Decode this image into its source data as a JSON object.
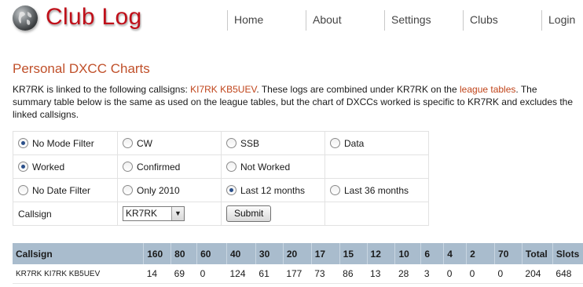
{
  "header": {
    "logo_text": "Club Log",
    "nav": [
      "Home",
      "About",
      "Settings",
      "Clubs",
      "Login"
    ]
  },
  "page": {
    "title": "Personal DXCC Charts",
    "intro": {
      "p1": "KR7RK is linked to the following callsigns: ",
      "linked_callsigns": "KI7RK KB5UEV",
      "p2": ". These logs are combined under KR7RK on the ",
      "league_link": "league tables",
      "p3": ". The summary table below is the same as used on the league tables, but the chart of DXCCs worked is specific to KR7RK and excludes the linked callsigns."
    }
  },
  "filters": {
    "mode": [
      "No Mode Filter",
      "CW",
      "SSB",
      "Data"
    ],
    "mode_selected": 0,
    "status": [
      "Worked",
      "Confirmed",
      "Not Worked"
    ],
    "status_selected": 0,
    "date": [
      "No Date Filter",
      "Only 2010",
      "Last 12 months",
      "Last 36 months"
    ],
    "date_selected": 2,
    "callsign_label": "Callsign",
    "callsign_value": "KR7RK",
    "submit_label": "Submit"
  },
  "summary": {
    "headers": [
      "Callsign",
      "160",
      "80",
      "60",
      "40",
      "30",
      "20",
      "17",
      "15",
      "12",
      "10",
      "6",
      "4",
      "2",
      "70",
      "Total",
      "Slots"
    ],
    "rows": [
      [
        "KR7RK KI7RK KB5UEV",
        "14",
        "69",
        "0",
        "124",
        "61",
        "177",
        "73",
        "86",
        "13",
        "28",
        "3",
        "0",
        "0",
        "0",
        "204",
        "648"
      ]
    ]
  }
}
